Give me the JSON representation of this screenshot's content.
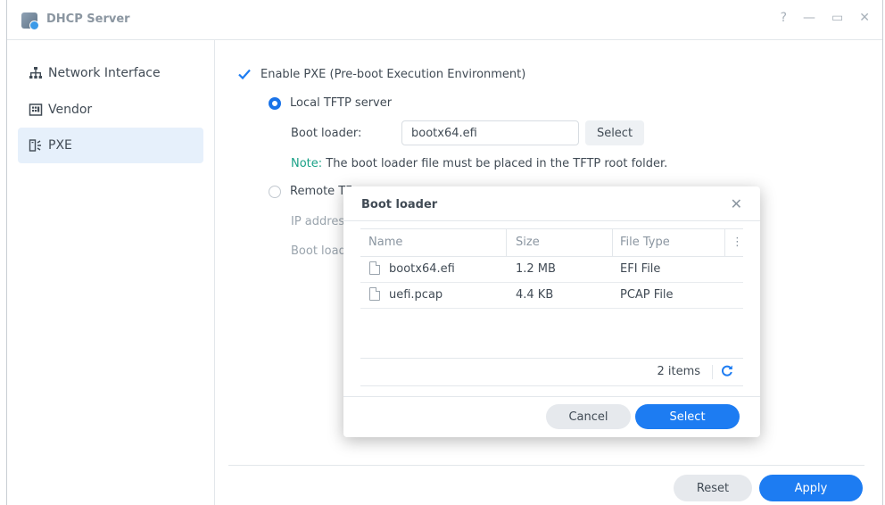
{
  "window": {
    "title": "DHCP Server",
    "controls": [
      "?",
      "—",
      "▭",
      "✕"
    ]
  },
  "sidebar": {
    "items": [
      {
        "label": "Network Interface",
        "icon": "network-icon"
      },
      {
        "label": "Vendor",
        "icon": "vendor-icon"
      },
      {
        "label": "PXE",
        "icon": "pxe-icon",
        "active": true
      }
    ]
  },
  "pxe": {
    "enable_label": "Enable PXE (Pre-boot Execution Environment)",
    "enabled": true,
    "local_label": "Local TFTP server",
    "boot_loader_label": "Boot loader:",
    "boot_loader_value": "bootx64.efi",
    "select_label": "Select",
    "note_prefix": "Note:",
    "note_text": " The boot loader file must be placed in the TFTP root folder.",
    "remote_label": "Remote TF",
    "ip_label": "IP address",
    "remote_boot_label": "Boot loade"
  },
  "footer": {
    "reset_label": "Reset",
    "apply_label": "Apply"
  },
  "dialog": {
    "title": "Boot loader",
    "columns": [
      "Name",
      "Size",
      "File Type"
    ],
    "rows": [
      {
        "name": "bootx64.efi",
        "size": "1.2 MB",
        "type": "EFI File"
      },
      {
        "name": "uefi.pcap",
        "size": "4.4 KB",
        "type": "PCAP File"
      }
    ],
    "item_count": "2 items",
    "cancel_label": "Cancel",
    "select_label": "Select"
  },
  "colors": {
    "accent": "#1d7cf2",
    "note": "#1aa187",
    "sidebar_active": "#e6f0fb"
  }
}
